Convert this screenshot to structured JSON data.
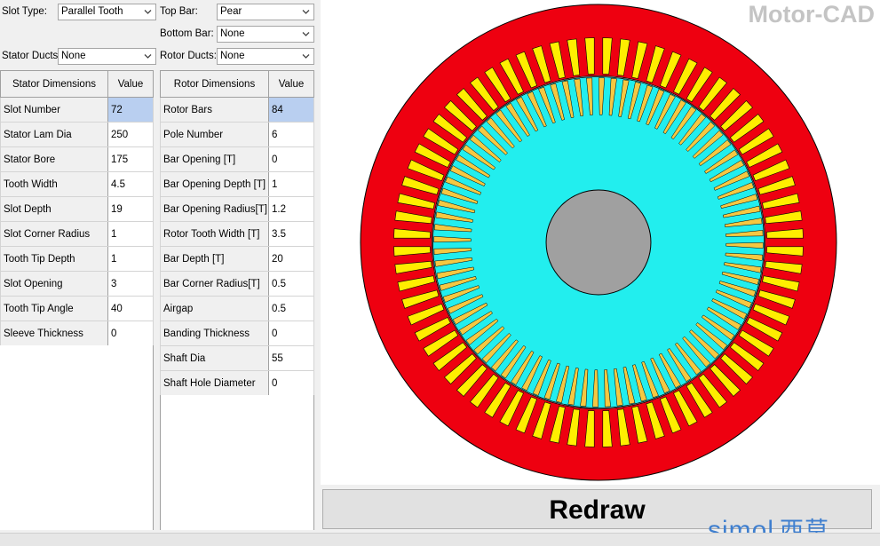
{
  "brand": "Motor-CAD",
  "controls": {
    "slot_type_label": "Slot Type:",
    "slot_type_value": "Parallel Tooth",
    "top_bar_label": "Top Bar:",
    "top_bar_value": "Pear",
    "bottom_bar_label": "Bottom Bar:",
    "bottom_bar_value": "None",
    "stator_ducts_label": "Stator Ducts:",
    "stator_ducts_value": "None",
    "rotor_ducts_label": "Rotor Ducts:",
    "rotor_ducts_value": "None"
  },
  "stator_table": {
    "header_name": "Stator Dimensions",
    "header_value": "Value",
    "rows": [
      {
        "name": "Slot Number",
        "value": "72"
      },
      {
        "name": "Stator Lam Dia",
        "value": "250"
      },
      {
        "name": "Stator Bore",
        "value": "175"
      },
      {
        "name": "Tooth Width",
        "value": "4.5"
      },
      {
        "name": "Slot Depth",
        "value": "19"
      },
      {
        "name": "Slot Corner Radius",
        "value": "1"
      },
      {
        "name": "Tooth Tip Depth",
        "value": "1"
      },
      {
        "name": "Slot Opening",
        "value": "3"
      },
      {
        "name": "Tooth Tip Angle",
        "value": "40"
      },
      {
        "name": "Sleeve Thickness",
        "value": "0"
      }
    ]
  },
  "rotor_table": {
    "header_name": "Rotor Dimensions",
    "header_value": "Value",
    "rows": [
      {
        "name": "Rotor Bars",
        "value": "84"
      },
      {
        "name": "Pole Number",
        "value": "6"
      },
      {
        "name": "Bar Opening [T]",
        "value": "0"
      },
      {
        "name": "Bar Opening Depth [T]",
        "value": "1"
      },
      {
        "name": "Bar Opening Radius[T]",
        "value": "1.2"
      },
      {
        "name": "Rotor Tooth Width [T]",
        "value": "3.5"
      },
      {
        "name": "Bar Depth [T]",
        "value": "20"
      },
      {
        "name": "Bar Corner Radius[T]",
        "value": "0.5"
      },
      {
        "name": "Airgap",
        "value": "0.5"
      },
      {
        "name": "Banding Thickness",
        "value": "0"
      },
      {
        "name": "Shaft Dia",
        "value": "55"
      },
      {
        "name": "Shaft Hole Diameter",
        "value": "0"
      }
    ]
  },
  "redraw_label": "Redraw",
  "watermark": {
    "latin": "simol",
    "cjk": "西莫"
  },
  "colors": {
    "stator_lamination": "#ee0010",
    "stator_winding": "#ffee00",
    "rotor_lamination": "#22eeee",
    "rotor_bar": "#f5c842",
    "shaft": "#a0a0a0",
    "selected_cell": "#b9cff0",
    "watermark": "#3f7fcf"
  }
}
